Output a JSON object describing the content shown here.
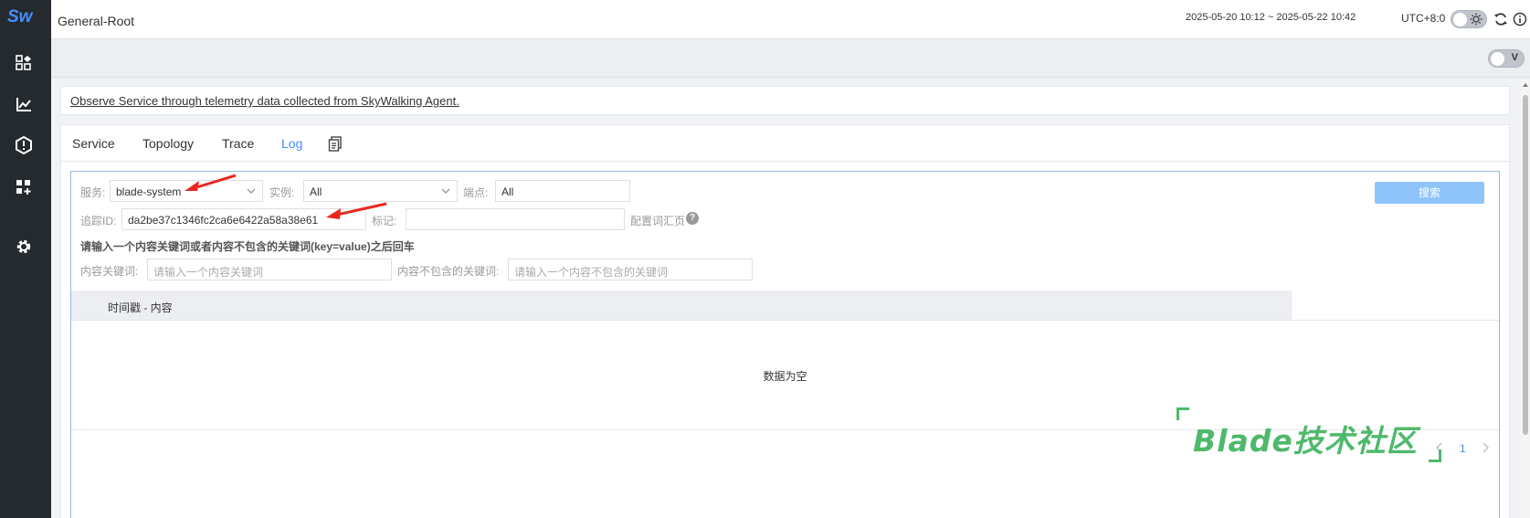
{
  "sidebar": {
    "logo": "Sw",
    "items": [
      {
        "name": "dashboard-icon"
      },
      {
        "name": "chart-icon"
      },
      {
        "name": "alert-icon"
      },
      {
        "name": "add-widget-icon"
      },
      {
        "name": "settings-icon"
      }
    ]
  },
  "header": {
    "title": "General-Root",
    "time_range": "2025-05-20 10:12 ~ 2025-05-22 10:42",
    "timezone": "UTC+8:0"
  },
  "subbar": {
    "toggle_label": "V"
  },
  "info": {
    "text": "Observe Service through telemetry data collected from SkyWalking Agent."
  },
  "tabs": [
    {
      "label": "Service"
    },
    {
      "label": "Topology"
    },
    {
      "label": "Trace"
    },
    {
      "label": "Log",
      "active": true
    }
  ],
  "filters": {
    "service_label": "服务:",
    "service_value": "blade-system",
    "instance_label": "实例:",
    "instance_value": "All",
    "endpoint_label": "端点:",
    "endpoint_value": "All",
    "trace_label": "追踪ID:",
    "trace_value": "da2be37c1346fc2ca6e6422a58a38e61",
    "tag_label": "标记:",
    "tag_value": "",
    "config_link": "配置词汇页",
    "search_button": "搜索",
    "hint": "请输入一个内容关键词或者内容不包含的关键词(key=value)之后回车",
    "keyword_label": "内容关键词:",
    "keyword_placeholder": "请输入一个内容关键词",
    "exclude_label": "内容不包含的关键词:",
    "exclude_placeholder": "请输入一个内容不包含的关键词"
  },
  "table": {
    "header": "时间戳 - 内容",
    "empty_text": "数据为空"
  },
  "pagination": {
    "page": "1"
  },
  "watermark": "Blade技术社区",
  "colors": {
    "accent": "#448dfe",
    "sidebar": "#252a2f",
    "annotation_arrow": "#e8281f",
    "watermark": "#4fb96b"
  }
}
